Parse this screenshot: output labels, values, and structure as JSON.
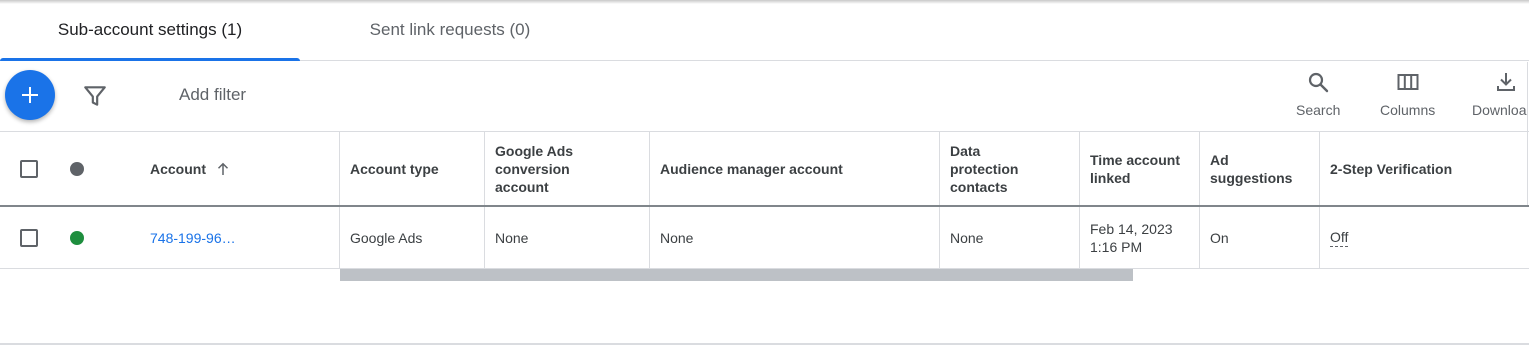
{
  "tabs": [
    {
      "label": "Sub-account settings (1)",
      "active": true
    },
    {
      "label": "Sent link requests (0)",
      "active": false
    }
  ],
  "toolbar": {
    "add_filter": "Add filter",
    "search": "Search",
    "columns": "Columns",
    "download": "Downloa"
  },
  "columns": {
    "account": "Account",
    "account_type": "Account type",
    "google_ads_conversion": "Google Ads conversion account",
    "audience_manager": "Audience manager account",
    "data_protection": "Data protection contacts",
    "time_linked": "Time account linked",
    "ad_suggestions": "Ad suggestions",
    "two_step": "2-Step Verification"
  },
  "rows": [
    {
      "account": "748-199-96…",
      "account_type": "Google Ads",
      "google_ads_conversion": "None",
      "audience_manager": "None",
      "data_protection": "None",
      "time_linked_date": "Feb 14, 2023",
      "time_linked_time": "1:16 PM",
      "ad_suggestions": "On",
      "two_step": "Off",
      "status": "enabled"
    }
  ],
  "colors": {
    "accent": "#1a73e8",
    "status_enabled": "#1e8e3e",
    "status_header": "#5f6368",
    "scrollbar": "#bdc1c6"
  },
  "icons": {
    "fab": "plus-icon",
    "filter": "filter-icon",
    "search": "search-icon",
    "columns": "columns-icon",
    "download": "download-icon",
    "sort": "arrow-up-icon"
  }
}
